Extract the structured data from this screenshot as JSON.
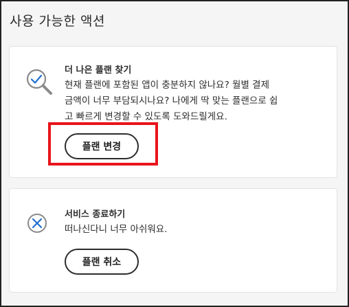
{
  "section": {
    "title": "사용 가능한 액션"
  },
  "find_plan": {
    "icon": "magnifier-check-icon",
    "heading": "더 나은 플랜 찾기",
    "line1": "현재 플랜에 포함된 앱이 충분하지 않나요? 월별 결제",
    "line2": "금액이 너무 부담되시나요? 나에게 딱 맞는 플랜으로 쉽",
    "line3": "고 빠르게 변경할 수 있도록 도와드릴게요.",
    "button_label": "플랜 변경"
  },
  "end_service": {
    "icon": "x-circle-icon",
    "heading": "서비스 종료하기",
    "text": "떠나신다니 너무 아쉬워요.",
    "button_label": "플랜 취소"
  },
  "colors": {
    "icon_blue": "#1f6fd1",
    "icon_gray": "#8a8a8a",
    "highlight_red": "#e8141b"
  }
}
